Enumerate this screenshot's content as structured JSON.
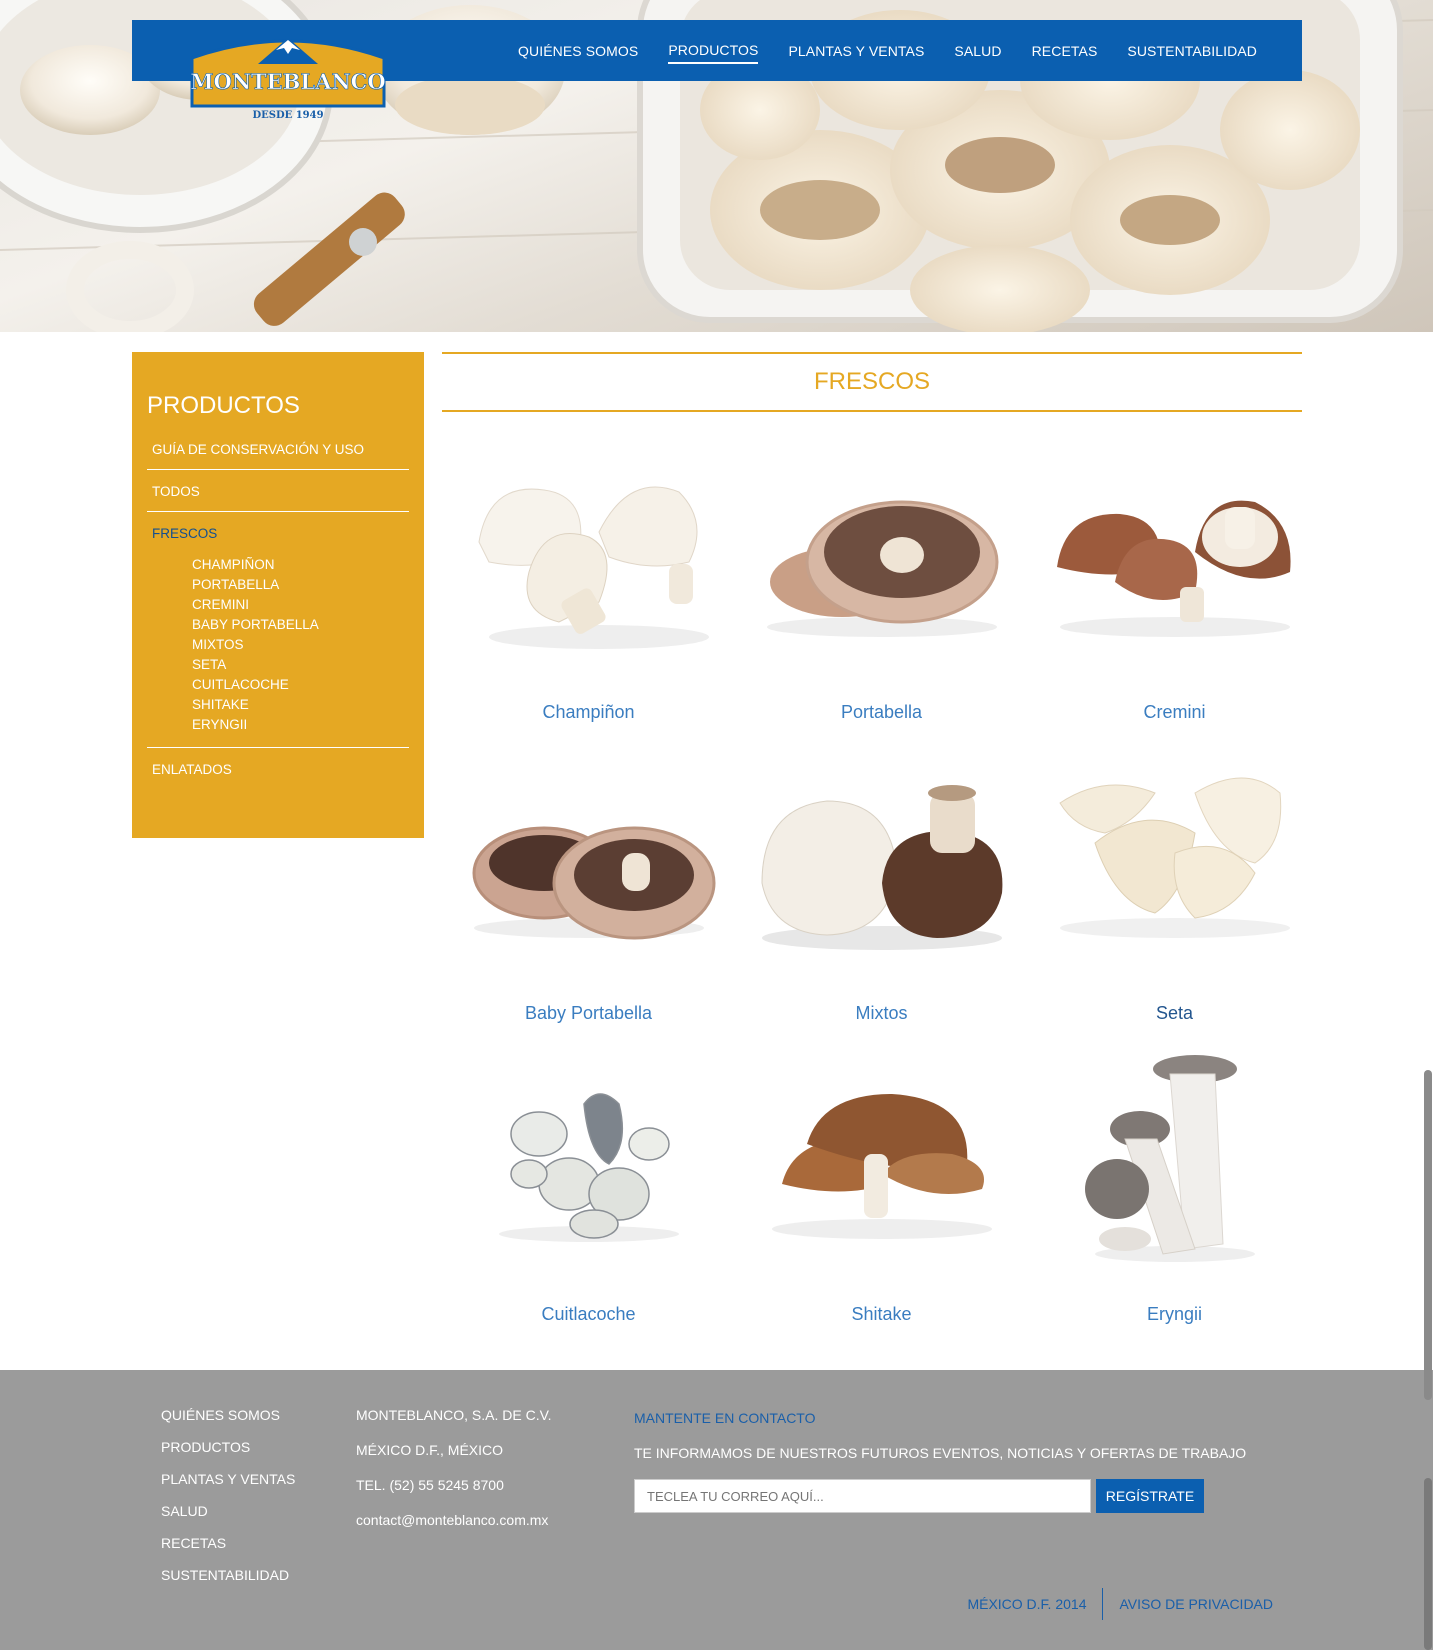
{
  "brand": {
    "name": "MONTEBLANCO",
    "tagline": "DESDE 1949"
  },
  "nav": {
    "items": [
      {
        "label": "QUIÉNES SOMOS",
        "active": false
      },
      {
        "label": "PRODUCTOS",
        "active": true
      },
      {
        "label": "PLANTAS Y VENTAS",
        "active": false
      },
      {
        "label": "SALUD",
        "active": false
      },
      {
        "label": "RECETAS",
        "active": false
      },
      {
        "label": "SUSTENTABILIDAD",
        "active": false
      }
    ]
  },
  "sidebar": {
    "title": "PRODUCTOS",
    "items": [
      {
        "label": "GUÍA DE CONSERVACIÓN Y USO"
      },
      {
        "label": "TODOS"
      },
      {
        "label": "FRESCOS",
        "active": true,
        "children": [
          "CHAMPIÑON",
          "PORTABELLA",
          "CREMINI",
          "BABY PORTABELLA",
          "MIXTOS",
          "SETA",
          "CUITLACOCHE",
          "SHITAKE",
          "ERYNGII"
        ]
      },
      {
        "label": "ENLATADOS"
      }
    ]
  },
  "main": {
    "section_title": "FRESCOS",
    "products": [
      {
        "name": "Champiñon",
        "icon": "champinon-image"
      },
      {
        "name": "Portabella",
        "icon": "portabella-image"
      },
      {
        "name": "Cremini",
        "icon": "cremini-image"
      },
      {
        "name": "Baby Portabella",
        "icon": "baby-portabella-image"
      },
      {
        "name": "Mixtos",
        "icon": "mixtos-image"
      },
      {
        "name": "Seta",
        "icon": "seta-image"
      },
      {
        "name": "Cuitlacoche",
        "icon": "cuitlacoche-image"
      },
      {
        "name": "Shitake",
        "icon": "shitake-image"
      },
      {
        "name": "Eryngii",
        "icon": "eryngii-image"
      }
    ]
  },
  "footer": {
    "links": [
      "QUIÉNES SOMOS",
      "PRODUCTOS",
      "PLANTAS Y VENTAS",
      "SALUD",
      "RECETAS",
      "SUSTENTABILIDAD"
    ],
    "company": [
      "MONTEBLANCO, S.A. DE C.V.",
      "MÉXICO D.F., MÉXICO",
      "TEL. (52) 55 5245 8700",
      "contact@monteblanco.com.mx"
    ],
    "newsletter": {
      "heading": "MANTENTE EN CONTACTO",
      "text": "TE INFORMAMOS DE NUESTROS FUTUROS EVENTOS, NOTICIAS Y OFERTAS DE TRABAJO",
      "placeholder": "TECLEA TU CORREO AQUÍ...",
      "button": "REGÍSTRATE"
    },
    "bottom": {
      "year": "MÉXICO D.F. 2014",
      "privacy": "AVISO DE PRIVACIDAD"
    }
  },
  "colors": {
    "nav_blue": "#0b5fb0",
    "gold": "#e5a823",
    "footer_gray": "#9b9b9b",
    "link_blue": "#3a7dc0"
  }
}
